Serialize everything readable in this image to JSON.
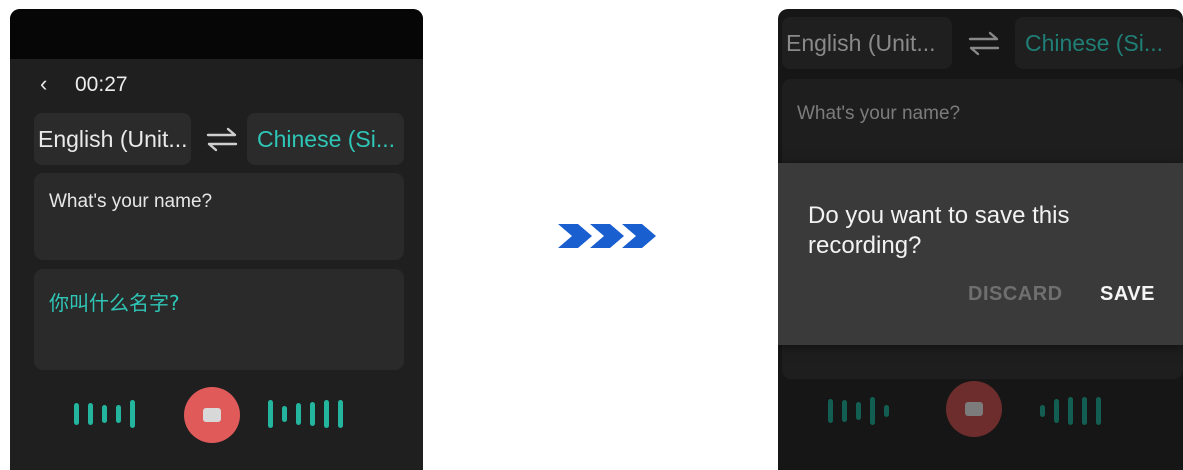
{
  "left_screen": {
    "timer": "00:27",
    "source_lang": "English (Unit...",
    "target_lang": "Chinese (Si...",
    "source_text": "What's your name?",
    "translated_text": "你叫什么名字?"
  },
  "right_screen": {
    "source_lang": "English (Unit...",
    "target_lang": "Chinese (Si...",
    "source_text": "What's your name?",
    "dialog": {
      "message": "Do you want to save this recording?",
      "discard_label": "DISCARD",
      "save_label": "SAVE"
    }
  },
  "icons": {
    "back": "chevron-left-icon",
    "swap": "swap-arrows-icon",
    "record_stop": "stop-icon",
    "transition": "triple-chevron-right-icon"
  },
  "colors": {
    "accent_teal": "#2ec6b6",
    "record_red": "#e05a5a",
    "wave_green": "#23b59d",
    "transition_blue": "#1a5fd0"
  }
}
